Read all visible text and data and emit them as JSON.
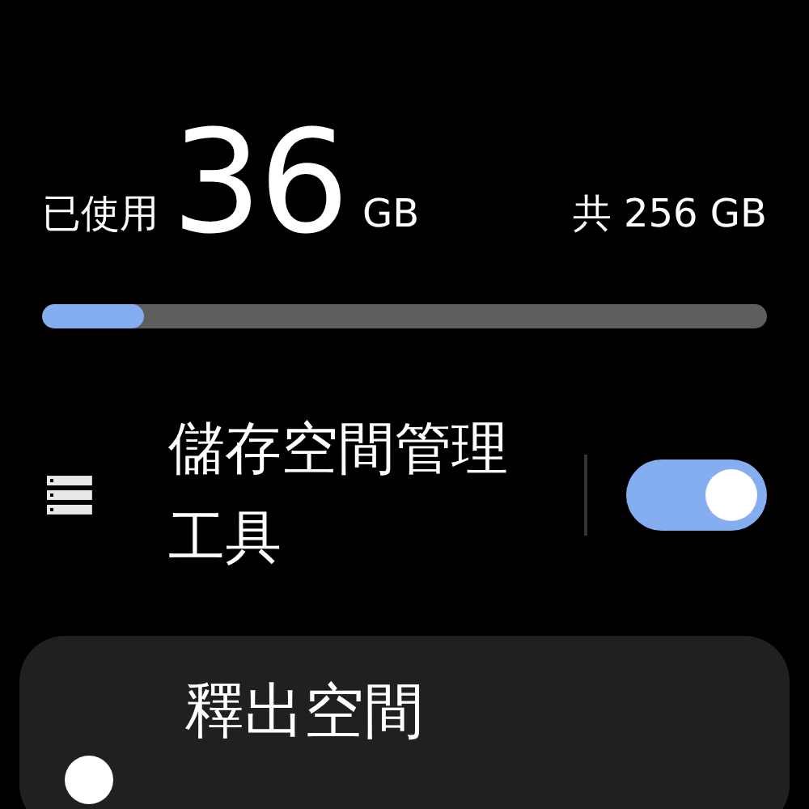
{
  "usage": {
    "used_label": "已使用",
    "used_value": "36",
    "used_unit": "GB",
    "total": "共 256 GB",
    "level": 0.14
  },
  "tool_row": {
    "label": "儲存空間管理工具",
    "on": true
  },
  "card": {
    "title": "釋出空間"
  }
}
